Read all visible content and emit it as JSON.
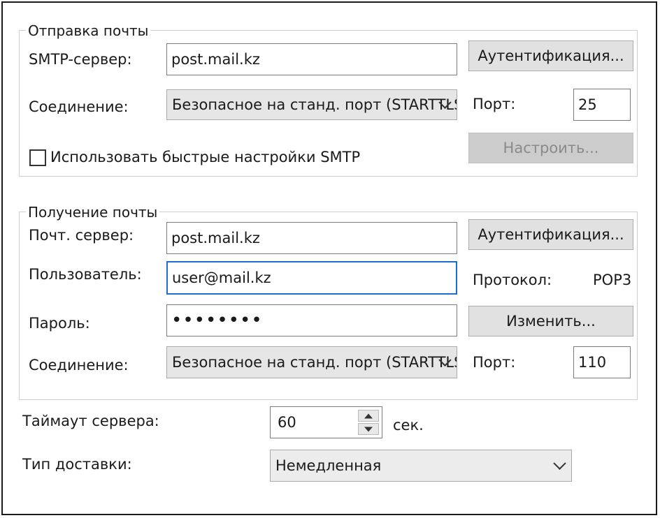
{
  "send": {
    "legend": "Отправка почты",
    "smtp_label": "SMTP-сервер:",
    "smtp_value": "post.mail.kz",
    "auth_button": "Аутентификация...",
    "connection_label": "Соединение:",
    "connection_value": "Безопасное на станд. порт (STARTTLS)",
    "port_label": "Порт:",
    "port_value": "25",
    "quick_settings_checkbox": "Использовать быстрые настройки SMTP",
    "quick_settings_checked": false,
    "configure_button": "Настроить..."
  },
  "receive": {
    "legend": "Получение почты",
    "server_label": "Почт. сервер:",
    "server_value": "post.mail.kz",
    "auth_button": "Аутентификация...",
    "user_label": "Пользователь:",
    "user_value": "user@mail.kz",
    "protocol_label": "Протокол:",
    "protocol_value": "POP3",
    "password_label": "Пароль:",
    "password_value": "••••••••",
    "change_button": "Изменить...",
    "connection_label": "Соединение:",
    "connection_value": "Безопасное на станд. порт (STARTTLS)",
    "port_label": "Порт:",
    "port_value": "110"
  },
  "timeout": {
    "label": "Таймаут сервера:",
    "value": "60",
    "unit": "сек."
  },
  "delivery": {
    "label": "Тип доставки:",
    "value": "Немедленная"
  }
}
